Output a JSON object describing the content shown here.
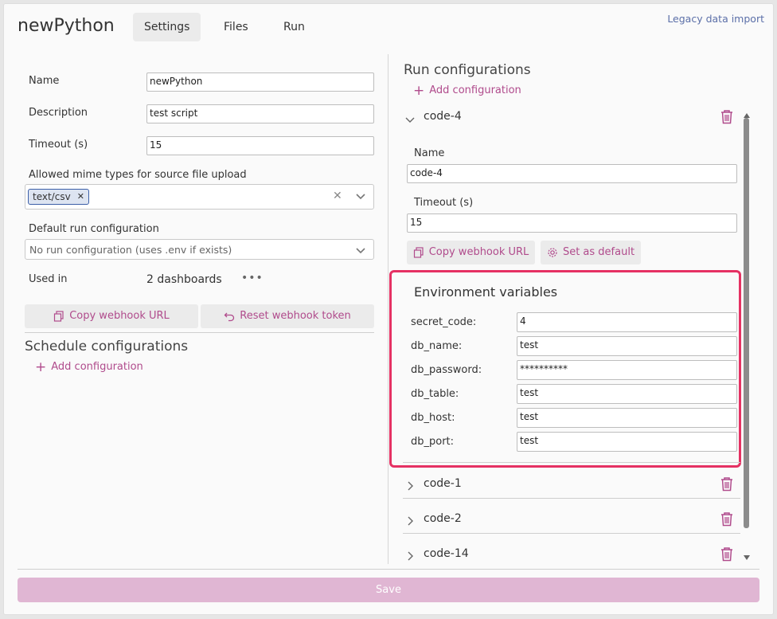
{
  "header": {
    "title": "newPython",
    "tabs": [
      {
        "label": "Settings",
        "active": true
      },
      {
        "label": "Files",
        "active": false
      },
      {
        "label": "Run",
        "active": false
      }
    ],
    "legacy_link": "Legacy data import"
  },
  "left": {
    "name_label": "Name",
    "name_value": "newPython",
    "description_label": "Description",
    "description_value": "test script",
    "timeout_label": "Timeout (s)",
    "timeout_value": "15",
    "mime_label": "Allowed mime types for source file upload",
    "mime_chip": "text/csv",
    "default_run_label": "Default run configuration",
    "default_run_value": "No run configuration (uses .env if exists)",
    "used_in_label": "Used in",
    "used_in_value": "2 dashboards",
    "copy_webhook": "Copy webhook URL",
    "reset_webhook": "Reset webhook token",
    "schedule_title": "Schedule configurations",
    "add_configuration": "Add configuration"
  },
  "right": {
    "title": "Run configurations",
    "add_configuration": "Add configuration",
    "expanded": {
      "name": "code-4",
      "name_label": "Name",
      "name_value": "code-4",
      "timeout_label": "Timeout (s)",
      "timeout_value": "15",
      "copy_webhook": "Copy webhook URL",
      "set_default": "Set as default",
      "env_title": "Environment variables",
      "env": [
        {
          "key": "secret_code:",
          "value": "4"
        },
        {
          "key": "db_name:",
          "value": "test"
        },
        {
          "key": "db_password:",
          "value": "**********"
        },
        {
          "key": "db_table:",
          "value": "test"
        },
        {
          "key": "db_host:",
          "value": "test"
        },
        {
          "key": "db_port:",
          "value": "test"
        }
      ]
    },
    "collapsed": [
      {
        "name": "code-1"
      },
      {
        "name": "code-2"
      },
      {
        "name": "code-14"
      }
    ]
  },
  "footer": {
    "save": "Save"
  },
  "colors": {
    "accent": "#b04b8c",
    "highlight": "#e53163",
    "save_disabled": "#e0b6d3"
  }
}
